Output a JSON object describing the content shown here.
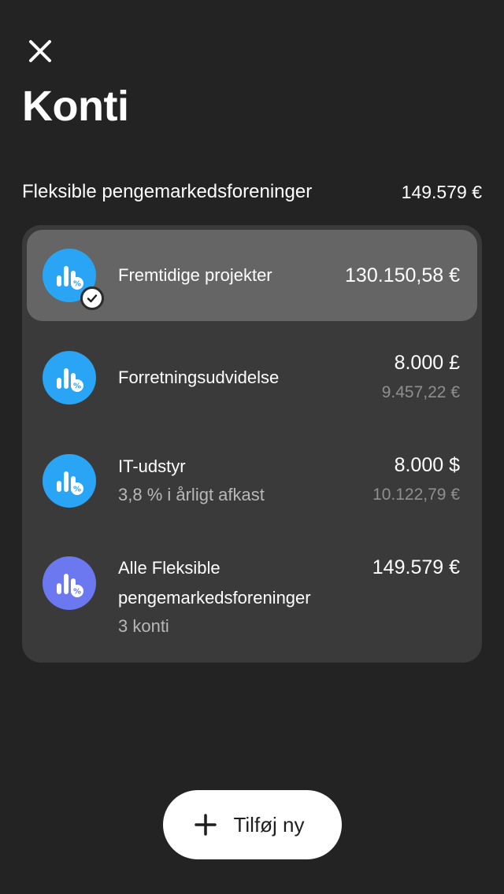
{
  "header": {
    "title": "Konti",
    "close_icon": "close-icon"
  },
  "section": {
    "label": "Fleksible pengemarkedsforeninger",
    "total": "149.579 €"
  },
  "accounts": [
    {
      "name": "Fremtidige projekter",
      "amount": "130.150,58 €",
      "selected": true,
      "icon": "money-market-fund-icon",
      "icon_color": "#2aa4f4"
    },
    {
      "name": "Forretningsudvidelse",
      "amount": "8.000 £",
      "amount_converted": "9.457,22 €",
      "icon": "money-market-fund-icon",
      "icon_color": "#2aa4f4"
    },
    {
      "name": "IT-udstyr",
      "subtitle": "3,8 % i årligt afkast",
      "amount": "8.000 $",
      "amount_converted": "10.122,79 €",
      "icon": "money-market-fund-icon",
      "icon_color": "#2aa4f4"
    },
    {
      "name_line1": "Alle Fleksible",
      "name_line2": "pengemarkedsforeninger",
      "subtitle": "3 konti",
      "amount": "149.579 €",
      "icon": "money-market-fund-icon",
      "icon_color": "#6b78f0"
    }
  ],
  "add_button": {
    "label": "Tilføj ny",
    "icon": "plus-icon"
  },
  "colors": {
    "background": "#232323",
    "card": "#3a3a3a",
    "selected_row": "#656565",
    "accent_blue": "#2aa4f4",
    "accent_purple": "#6b78f0"
  }
}
